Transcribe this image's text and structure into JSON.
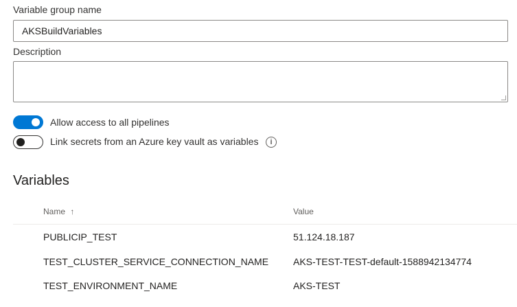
{
  "form": {
    "group_name_label": "Variable group name",
    "group_name_value": "AKSBuildVariables",
    "description_label": "Description",
    "description_value": ""
  },
  "toggles": [
    {
      "label": "Allow access to all pipelines",
      "on": true
    },
    {
      "label": "Link secrets from an Azure key vault as variables",
      "on": false
    }
  ],
  "info_icon_glyph": "i",
  "variables": {
    "title": "Variables",
    "columns": {
      "name": "Name",
      "sort_glyph": "↑",
      "value": "Value"
    },
    "rows": [
      {
        "name": "PUBLICIP_TEST",
        "value": "51.124.18.187"
      },
      {
        "name": "TEST_CLUSTER_SERVICE_CONNECTION_NAME",
        "value": "AKS-TEST-TEST-default-1588942134774"
      },
      {
        "name": "TEST_ENVIRONMENT_NAME",
        "value": "AKS-TEST"
      }
    ]
  },
  "colors": {
    "accent": "#0078d4",
    "border": "#8a8886",
    "divider": "#edebe9"
  }
}
